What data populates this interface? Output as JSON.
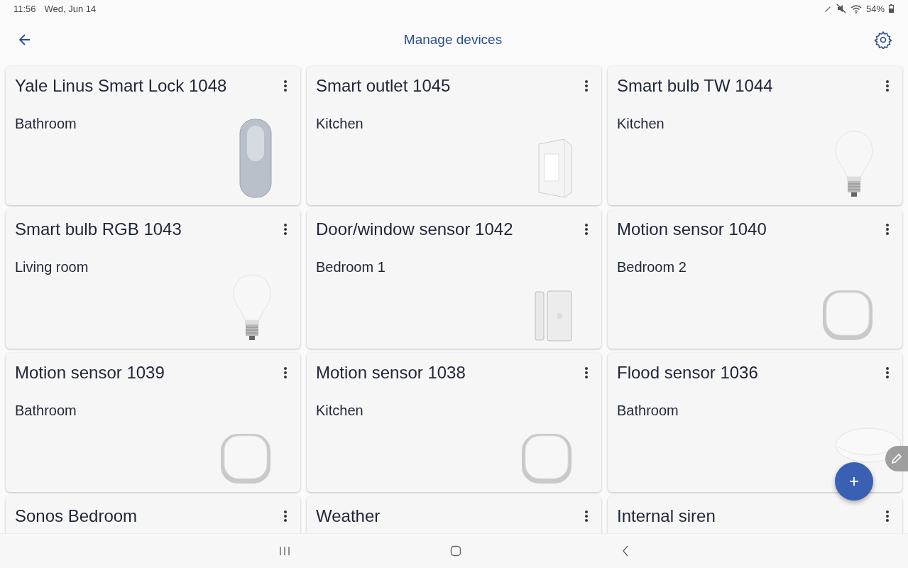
{
  "status_bar": {
    "time": "11:56",
    "date": "Wed, Jun 14",
    "battery": "54%"
  },
  "header": {
    "title": "Manage devices"
  },
  "devices": [
    {
      "name": "Yale Linus Smart Lock 1048",
      "room": "Bathroom",
      "kind": "lock"
    },
    {
      "name": "Smart outlet 1045",
      "room": "Kitchen",
      "kind": "outlet"
    },
    {
      "name": "Smart bulb TW 1044",
      "room": "Kitchen",
      "kind": "bulb"
    },
    {
      "name": "Smart bulb RGB 1043",
      "room": "Living room",
      "kind": "bulb"
    },
    {
      "name": "Door/window sensor 1042",
      "room": "Bedroom 1",
      "kind": "contact"
    },
    {
      "name": "Motion sensor 1040",
      "room": "Bedroom 2",
      "kind": "motion"
    },
    {
      "name": "Motion sensor 1039",
      "room": "Bathroom",
      "kind": "motion"
    },
    {
      "name": "Motion sensor 1038",
      "room": "Kitchen",
      "kind": "motion"
    },
    {
      "name": "Flood sensor 1036",
      "room": "Bathroom",
      "kind": "flood"
    },
    {
      "name": "Sonos Bedroom",
      "kind": "none"
    },
    {
      "name": "Weather",
      "kind": "none"
    },
    {
      "name": "Internal siren",
      "kind": "none"
    }
  ]
}
